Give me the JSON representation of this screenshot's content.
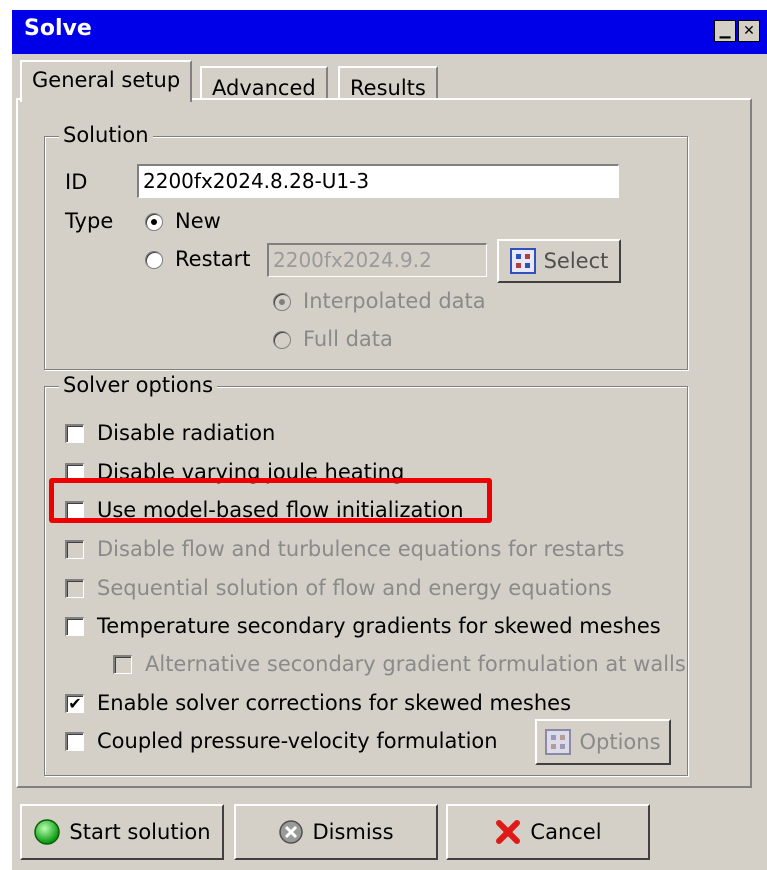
{
  "window": {
    "title": "Solve",
    "minimize_glyph": "▁",
    "close_glyph": "✕"
  },
  "tabs": [
    {
      "label": "General setup",
      "active": true
    },
    {
      "label": "Advanced",
      "active": false
    },
    {
      "label": "Results",
      "active": false
    }
  ],
  "solution": {
    "group_label": "Solution",
    "id_label": "ID",
    "id_value": "2200fx2024.8.28-U1-3",
    "type_label": "Type",
    "new_label": "New",
    "restart_label": "Restart",
    "restart_value": "2200fx2024.9.2",
    "select_label": "Select",
    "interpolated_label": "Interpolated data",
    "full_label": "Full data"
  },
  "solver_options": {
    "group_label": "Solver options",
    "items": [
      {
        "label": "Disable radiation",
        "checked": false,
        "enabled": true
      },
      {
        "label": "Disable varying joule heating",
        "checked": false,
        "enabled": true
      },
      {
        "label": "Use model-based flow initialization",
        "checked": false,
        "enabled": true
      },
      {
        "label": "Disable flow and turbulence equations for restarts",
        "checked": false,
        "enabled": false
      },
      {
        "label": "Sequential solution of flow and energy equations",
        "checked": false,
        "enabled": false
      },
      {
        "label": "Temperature secondary gradients for skewed meshes",
        "checked": false,
        "enabled": true
      },
      {
        "label": "Alternative secondary gradient formulation at walls",
        "checked": false,
        "enabled": false
      },
      {
        "label": "Enable solver corrections for skewed meshes",
        "checked": true,
        "enabled": true
      },
      {
        "label": "Coupled pressure-velocity formulation",
        "checked": false,
        "enabled": true
      }
    ],
    "options_label": "Options"
  },
  "buttons": {
    "start": "Start solution",
    "dismiss": "Dismiss",
    "cancel": "Cancel"
  },
  "colors": {
    "titlebar": "#0000e8",
    "highlight": "#ee0000",
    "face": "#d4d0c8"
  }
}
